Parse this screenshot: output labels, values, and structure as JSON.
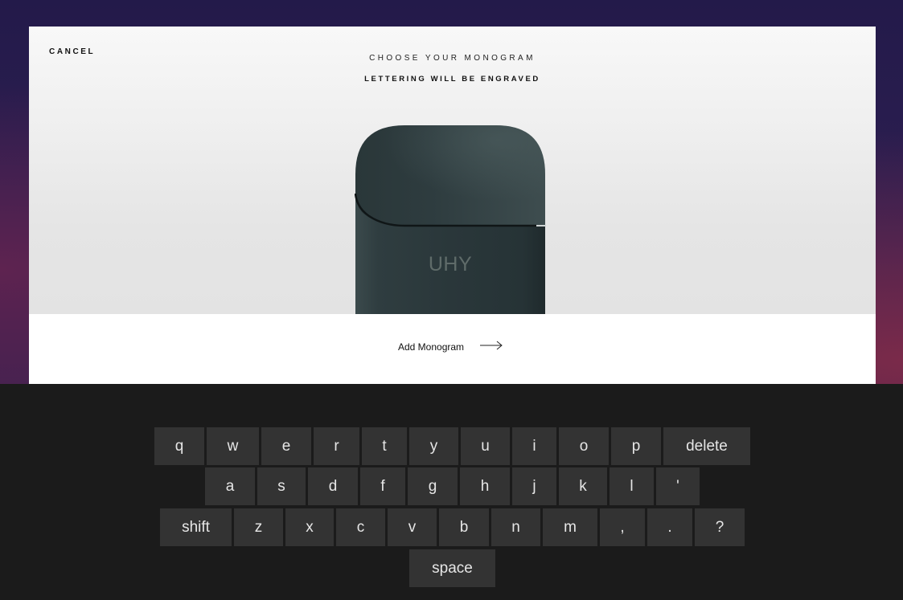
{
  "modal": {
    "cancel_label": "CANCEL",
    "title": "CHOOSE YOUR MONOGRAM",
    "subtitle": "LETTERING WILL BE ENGRAVED",
    "monogram_value": "UHY",
    "add_label": "Add Monogram",
    "arrow_icon": "arrow-right-icon"
  },
  "keyboard": {
    "row1": [
      "q",
      "w",
      "e",
      "r",
      "t",
      "y",
      "u",
      "i",
      "o",
      "p",
      "delete"
    ],
    "row2": [
      "a",
      "s",
      "d",
      "f",
      "g",
      "h",
      "j",
      "k",
      "l",
      "'"
    ],
    "row3": [
      "shift",
      "z",
      "x",
      "c",
      "v",
      "b",
      "n",
      "m",
      ",",
      ".",
      "?"
    ],
    "row4": [
      "space"
    ]
  },
  "colors": {
    "case": "#2c3a3d",
    "keyboard_bg": "#1b1b1b",
    "key_bg": "#333333",
    "key_text": "#e6e6e6"
  }
}
